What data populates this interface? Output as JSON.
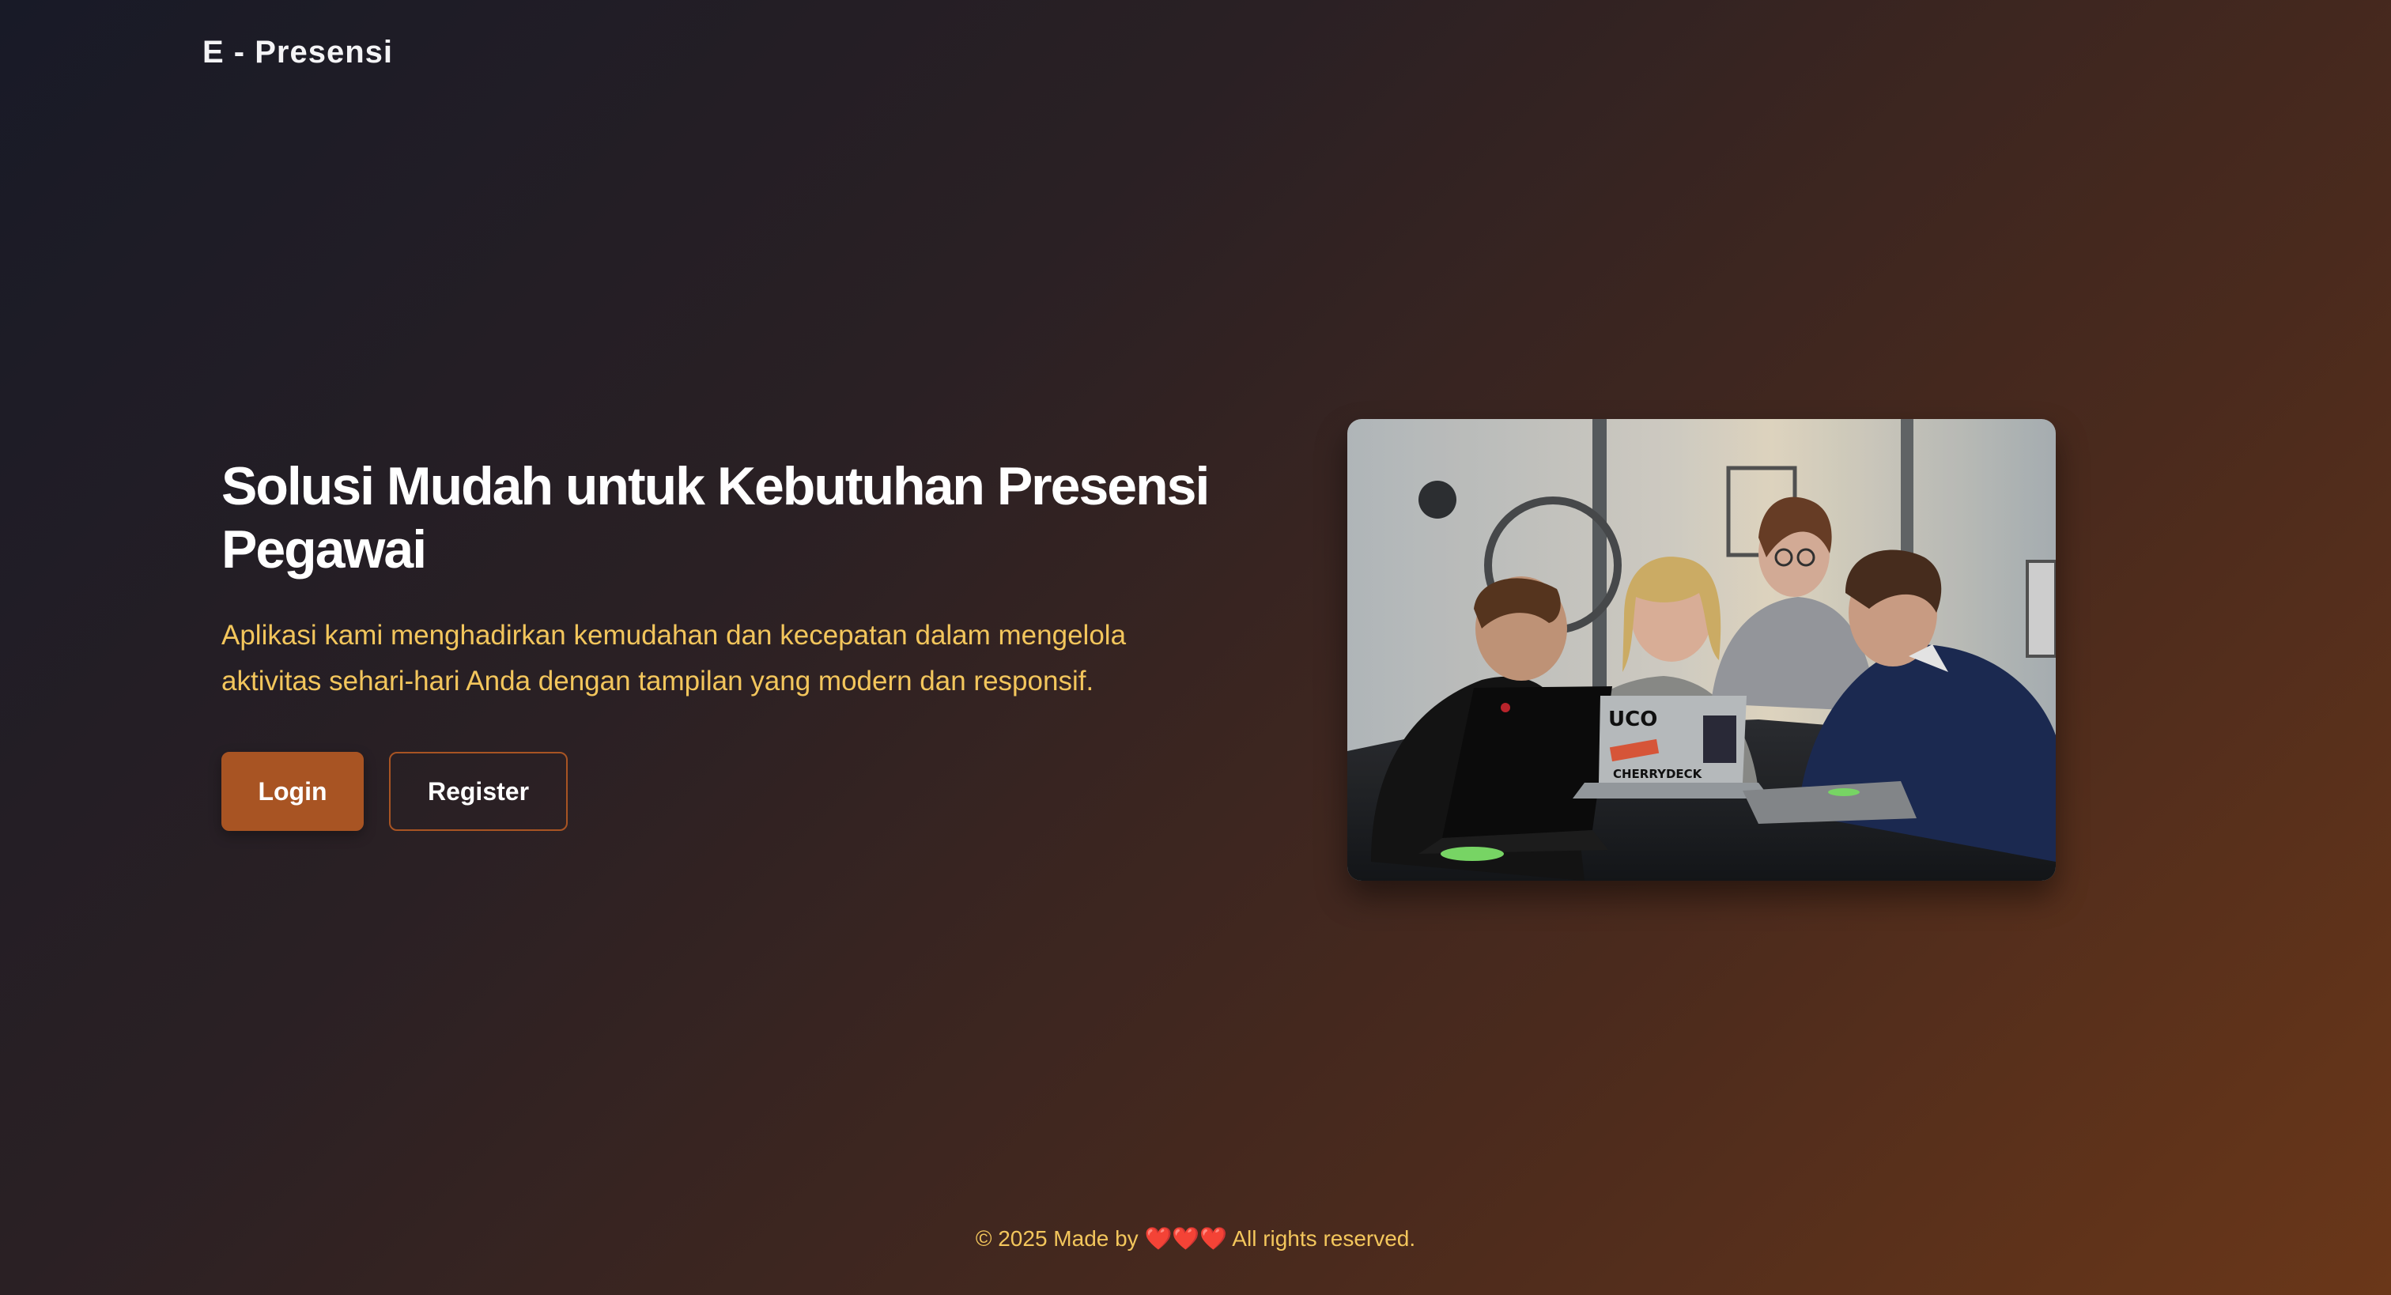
{
  "header": {
    "brand": "E - Presensi"
  },
  "hero": {
    "title": "Solusi Mudah untuk Kebutuhan Presensi Pegawai",
    "description": "Aplikasi kami menghadirkan kemudahan dan kecepatan dalam mengelola aktivitas sehari-hari Anda dengan tampilan yang modern dan responsif.",
    "login_label": "Login",
    "register_label": "Register",
    "image_texts": {
      "sticker_brand": "CHERRYDECK",
      "sticker_logo": "UCO"
    }
  },
  "footer": {
    "prefix": "© 2025 Made by",
    "hearts": "❤️❤️❤️",
    "suffix": "All rights reserved."
  },
  "colors": {
    "accent": "#a85423",
    "highlight_text": "#f3c65c",
    "background_start": "#181a27",
    "background_end": "#6a3719"
  }
}
